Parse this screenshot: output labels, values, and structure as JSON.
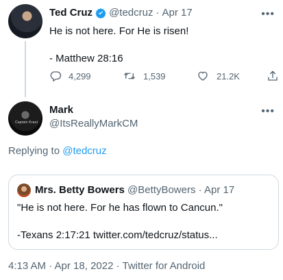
{
  "tweet": {
    "author_name": "Ted Cruz",
    "handle": "@tedcruz",
    "separator": "·",
    "date": "Apr 17",
    "lines": [
      "He is not here. For He is risen!",
      "- Matthew 28:16"
    ],
    "stats": {
      "replies": "4,299",
      "retweets": "1,539",
      "likes": "21.2K"
    }
  },
  "reply": {
    "author_name": "Mark",
    "handle": "@ItsReallyMarkCM",
    "avatar_tag": "Captain Kraut",
    "replying_prefix": "Replying to",
    "replying_to": "@tedcruz",
    "quote": {
      "author_name": "Mrs. Betty Bowers",
      "handle": "@BettyBowers",
      "separator": "·",
      "date": "Apr 17",
      "lines": [
        "\"He is not here. For he has flown to Cancun.\"",
        "-Texans 2:17:21 twitter.com/tedcruz/status..."
      ]
    },
    "meta": "4:13 AM · Apr 18, 2022 · Twitter for Android"
  },
  "colors": {
    "accent": "#1d9bf0",
    "muted": "#536471",
    "border": "#cfd9de"
  }
}
